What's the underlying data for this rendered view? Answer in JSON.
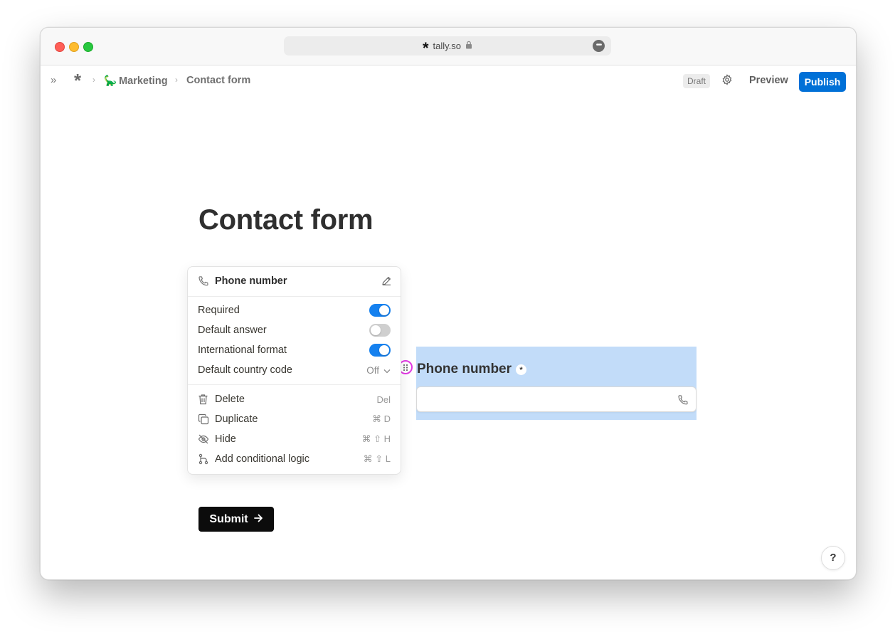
{
  "browser": {
    "url": "tally.so"
  },
  "header": {
    "breadcrumb": {
      "workspace": "Marketing",
      "workspace_emoji": "🦕",
      "form": "Contact form"
    },
    "status_badge": "Draft",
    "preview_label": "Preview",
    "publish_label": "Publish"
  },
  "form": {
    "title": "Contact form",
    "field": {
      "label": "Phone number",
      "required_mark": "*"
    },
    "submit_label": "Submit"
  },
  "block_menu": {
    "title": "Phone number",
    "options": [
      {
        "label": "Required",
        "enabled": true
      },
      {
        "label": "Default answer",
        "enabled": false
      },
      {
        "label": "International format",
        "enabled": true
      }
    ],
    "country_code": {
      "label": "Default country code",
      "value": "Off"
    },
    "actions": [
      {
        "label": "Delete",
        "shortcut": "Del",
        "icon": "trash-icon"
      },
      {
        "label": "Duplicate",
        "shortcut": "⌘ D",
        "icon": "duplicate-icon"
      },
      {
        "label": "Hide",
        "shortcut": "⌘ ⇧ H",
        "icon": "eye-off-icon"
      },
      {
        "label": "Add conditional logic",
        "shortcut": "⌘ ⇧ L",
        "icon": "branch-icon"
      }
    ]
  },
  "help_label": "?",
  "colors": {
    "accent": "#0070d7",
    "toggle_on": "#1581ef",
    "selection": "#c2dcf9",
    "drag_highlight": "#e23ae3"
  }
}
